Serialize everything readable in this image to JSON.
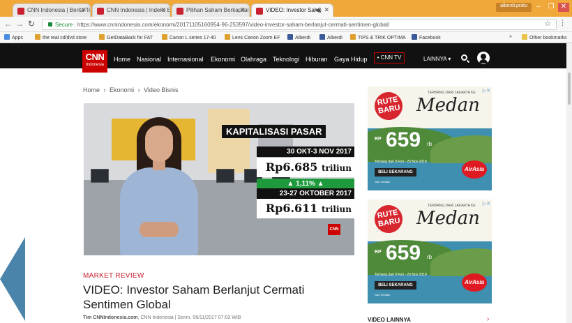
{
  "browser": {
    "tabs": [
      {
        "label": "CNN Indonesia | Berita Te"
      },
      {
        "label": "CNN Indonesia | Indeks Be"
      },
      {
        "label": "Pilihan Saham Berkapital"
      },
      {
        "label": "VIDEO: Investor Saha"
      }
    ],
    "profile": "alberdi.pratu",
    "address": {
      "secure_label": "Secure",
      "url": "https://www.cnnindonesia.com/ekonomi/20171105160954-96-253597/video-investor-saham-berlanjut-cermati-sentimen-global/"
    },
    "bookmarks": [
      {
        "label": "Apps",
        "icon": "apps-grid-icon"
      },
      {
        "label": "the real cd/dvd store",
        "icon": "page-icon"
      },
      {
        "label": "GetDataBack for FAT",
        "icon": "page-icon"
      },
      {
        "label": "Canon L series 17-40",
        "icon": "page-icon"
      },
      {
        "label": "Lens Canon Zoom EF",
        "icon": "page-icon"
      },
      {
        "label": "Alberdi",
        "icon": "facebook-icon"
      },
      {
        "label": "Alberdi",
        "icon": "facebook-icon"
      },
      {
        "label": "TIPS & TRIK OPTIMA",
        "icon": "page-icon"
      },
      {
        "label": "Facebook",
        "icon": "facebook-icon"
      }
    ],
    "other_bookmarks": "Other bookmarks",
    "more_bookmarks": "»"
  },
  "site": {
    "logo_main": "CNN",
    "logo_sub": "Indonesia",
    "nav": [
      "Home",
      "Nasional",
      "Internasional",
      "Ekonomi",
      "Olahraga",
      "Teknologi",
      "Hiburan",
      "Gaya Hidup"
    ],
    "cnn_tv": "• CNN TV",
    "more": "LAINNYA ▾"
  },
  "breadcrumb": {
    "items": [
      "Home",
      "Ekonomi",
      "Video Bisnis"
    ],
    "sep": "›"
  },
  "video": {
    "caption_title": "KAPITALISASI PASAR",
    "period1": "30 OKT-3 NOV 2017",
    "value1": "Rp6.685",
    "value1_unit": "triliun",
    "change": "▲ 1,11% ▲",
    "period2": "23-27 OKTOBER 2017",
    "value2": "Rp6.611",
    "value2_unit": "triliun",
    "logo": "CNN"
  },
  "article": {
    "kicker": "MARKET REVIEW",
    "title": "VIDEO: Investor Saham Berlanjut Cermati Sentimen Global",
    "author": "Tim CNNIndonesia.com",
    "meta": ", CNN Indonesia | Senin, 06/11/2017 07:03 WIB"
  },
  "ads": [
    {
      "badge": "RUTE BARU",
      "tagline": "TERBANG DARI JAKARTA KE",
      "city": "Medan",
      "rp": "RP",
      "price": "659",
      "unit": "rb",
      "info": "Terbang dari 9 Feb - 25 Nov 2018",
      "cta": "BELI SEKARANG",
      "fine": "S&K berlaku",
      "brand": "AirAsia",
      "adchoice": "▷✕"
    },
    {
      "badge": "RUTE BARU",
      "tagline": "TERBANG DARI JAKARTA KE",
      "city": "Medan",
      "rp": "RP",
      "price": "659",
      "unit": "rb",
      "info": "Terbang dari 9 Feb - 25 Nov 2018",
      "cta": "BELI SEKARANG",
      "fine": "S&K berlaku",
      "brand": "AirAsia",
      "adchoice": "▷✕"
    }
  ],
  "sidebar": {
    "video_lainnya": "VIDEO LAINNYA",
    "arrow": "›"
  }
}
